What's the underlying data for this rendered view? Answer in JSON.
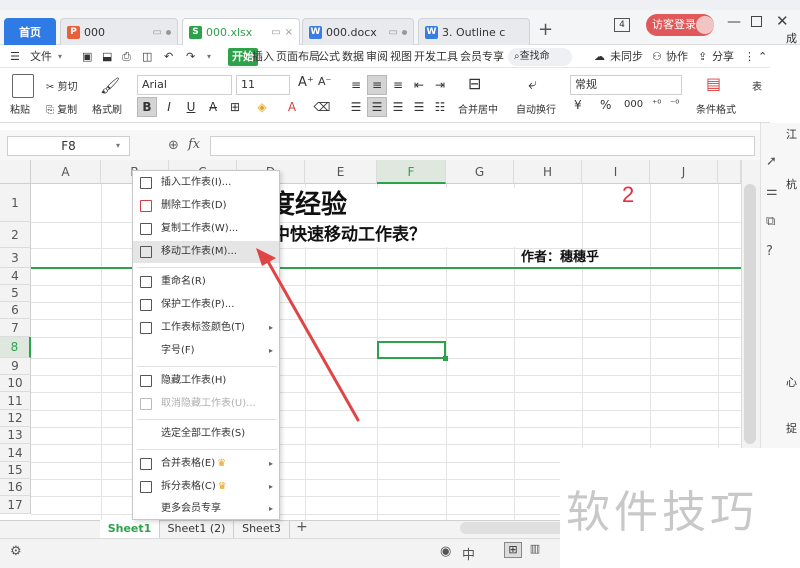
{
  "tabs": {
    "home": "首页",
    "tab1": "000",
    "tab2": "000.xlsx",
    "tab3": "000.docx",
    "tab4": "3. Outline c",
    "add": "+",
    "page_count": "4",
    "visitor_login": "访客登录"
  },
  "menu": {
    "file": "文件",
    "items": [
      "开始",
      "插入",
      "页面布局",
      "公式",
      "数据",
      "审阅",
      "视图",
      "开发工具",
      "会员专享"
    ],
    "search": "查找命",
    "unsync": "未同步",
    "collab": "协作",
    "share": "分享"
  },
  "ribbon": {
    "cut": "剪切",
    "copy": "复制",
    "paste": "粘贴",
    "format_painter": "格式刷",
    "font": "Arial",
    "size": "11",
    "merge": "合并居中",
    "wrap": "自动换行",
    "number_format": "常规",
    "cond_format": "条件格式",
    "table": "表",
    "bold": "B",
    "italic": "I",
    "underline": "U",
    "percent": "%",
    "thousands": "000"
  },
  "formula": {
    "namebox": "F8",
    "fx": "fx"
  },
  "grid": {
    "columns": [
      "A",
      "B",
      "C",
      "D",
      "E",
      "F",
      "G",
      "H",
      "I",
      "J"
    ],
    "rows": [
      "1",
      "2",
      "3",
      "4",
      "5",
      "6",
      "7",
      "8",
      "9",
      "10",
      "11",
      "12",
      "13",
      "14",
      "15",
      "16",
      "17"
    ],
    "selected_col": "F",
    "selected_row": "8",
    "cell_title": "度经验",
    "cell_subtitle": "中快速移动工作表？",
    "cell_author": "作者：穗穗乎",
    "annotation": "2"
  },
  "context_menu": {
    "items": [
      {
        "label": "插入工作表(I)..."
      },
      {
        "label": "删除工作表(D)"
      },
      {
        "label": "复制工作表(W)..."
      },
      {
        "label": "移动工作表(M)..."
      },
      {
        "label": "重命名(R)"
      },
      {
        "label": "保护工作表(P)..."
      },
      {
        "label": "工作表标签颜色(T)"
      },
      {
        "label": "字号(F)"
      },
      {
        "label": "隐藏工作表(H)"
      },
      {
        "label": "取消隐藏工作表(U)..."
      },
      {
        "label": "选定全部工作表(S)"
      },
      {
        "label": "合并表格(E)"
      },
      {
        "label": "拆分表格(C)"
      },
      {
        "label": "更多会员专享"
      }
    ]
  },
  "sheets": [
    "Sheet1",
    "Sheet1 (2)",
    "Sheet3"
  ],
  "watermark": "软件技巧",
  "right_panel_text": [
    "成",
    "江",
    "杭",
    "心",
    "捉"
  ],
  "colors": {
    "accent": "#2ea24a",
    "home_tab": "#2f7be5",
    "login": "#e0585a",
    "arrow": "#e04545",
    "annotation": "#e0303a"
  }
}
